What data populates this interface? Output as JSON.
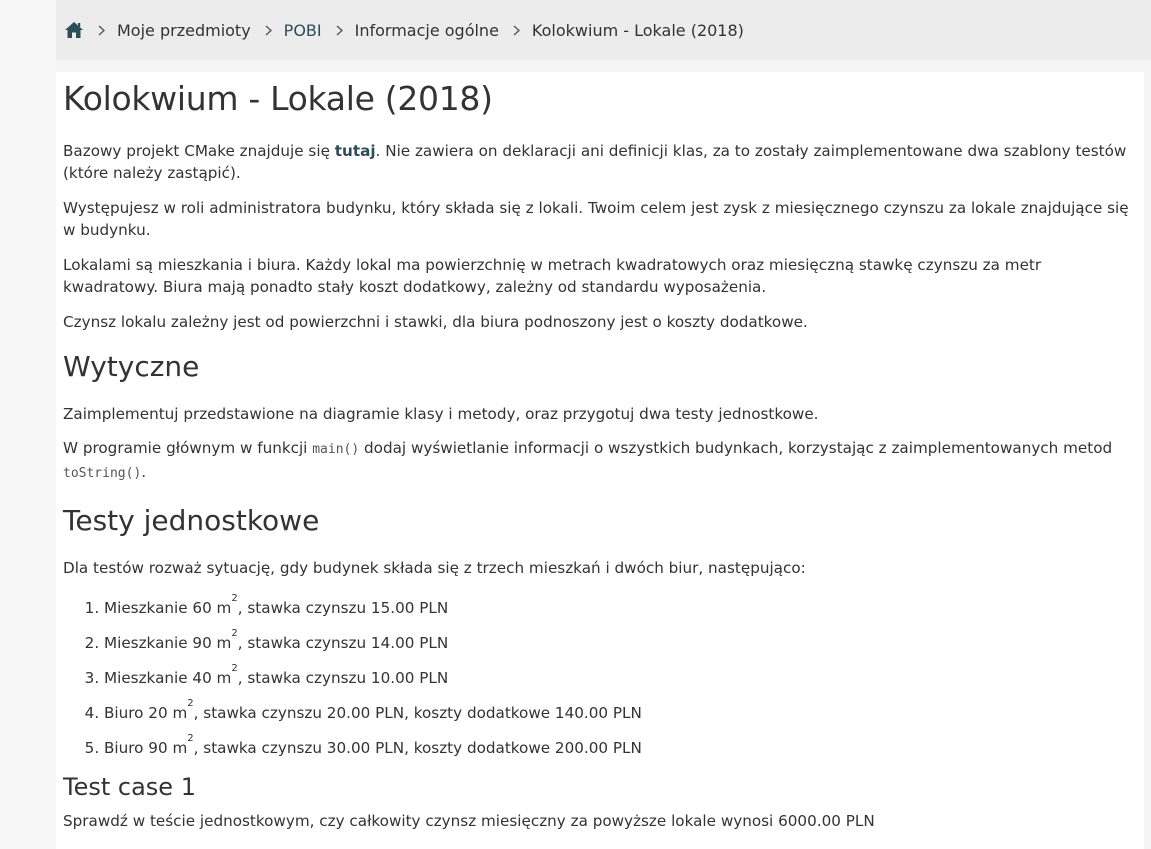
{
  "breadcrumb": {
    "home_icon": "home-icon",
    "items": [
      "Moje przedmioty",
      "POBI",
      "Informacje ogólne",
      "Kolokwium - Lokale (2018)"
    ]
  },
  "page": {
    "title": "Kolokwium - Lokale (2018)",
    "intro_1_pre": "Bazowy projekt CMake znajduje się ",
    "intro_1_link": "tutaj",
    "intro_1_post": ". Nie zawiera on deklaracji ani definicji klas, za to zostały zaimplementowane dwa szablony testów (które należy zastąpić).",
    "intro_2": "Występujesz w roli administratora budynku, który składa się z lokali. Twoim celem jest zysk z miesięcznego czynszu za lokale znajdujące się w budynku.",
    "intro_3": "Lokalami są mieszkania i biura. Każdy lokal ma powierzchnię w metrach kwadratowych oraz miesięczną stawkę czynszu za metr kwadratowy. Biura mają ponadto stały koszt dodatkowy, zależny od standardu wyposażenia.",
    "intro_4": "Czynsz lokalu zależny jest od powierzchni i stawki, dla biura podnoszony jest o koszty dodatkowe."
  },
  "guidelines": {
    "heading": "Wytyczne",
    "p1": "Zaimplementuj przedstawione na diagramie klasy i metody, oraz przygotuj dwa testy jednostkowe.",
    "p2_pre": "W programie głównym w funkcji ",
    "p2_code1": "main()",
    "p2_mid": " dodaj wyświetlanie informacji o wszystkich budynkach, korzystając z zaimplementowanych metod ",
    "p2_code2": "toString()",
    "p2_post": "."
  },
  "tests": {
    "heading": "Testy jednostkowe",
    "intro": "Dla testów rozważ sytuację, gdy budynek składa się z trzech mieszkań i dwóch biur, następująco:",
    "items": [
      {
        "pre": "Mieszkanie 60 m",
        "sup": "2",
        "post": ", stawka czynszu 15.00 PLN"
      },
      {
        "pre": "Mieszkanie 90 m",
        "sup": "2",
        "post": ", stawka czynszu 14.00 PLN"
      },
      {
        "pre": "Mieszkanie 40 m",
        "sup": "2",
        "post": ", stawka czynszu 10.00 PLN"
      },
      {
        "pre": "Biuro 20 m",
        "sup": "2",
        "post": ", stawka czynszu 20.00 PLN, koszty dodatkowe 140.00 PLN"
      },
      {
        "pre": "Biuro 90 m",
        "sup": "2",
        "post": ", stawka czynszu 30.00 PLN, koszty dodatkowe 200.00 PLN"
      }
    ]
  },
  "test_case_1": {
    "heading": "Test case 1",
    "text": "Sprawdź w teście jednostkowym, czy całkowity czynsz miesięczny za powyższe lokale wynosi 6000.00 PLN"
  },
  "colors": {
    "accent": "#2b4e5a",
    "text": "#333333",
    "breadcrumb_bg": "#ececec"
  }
}
